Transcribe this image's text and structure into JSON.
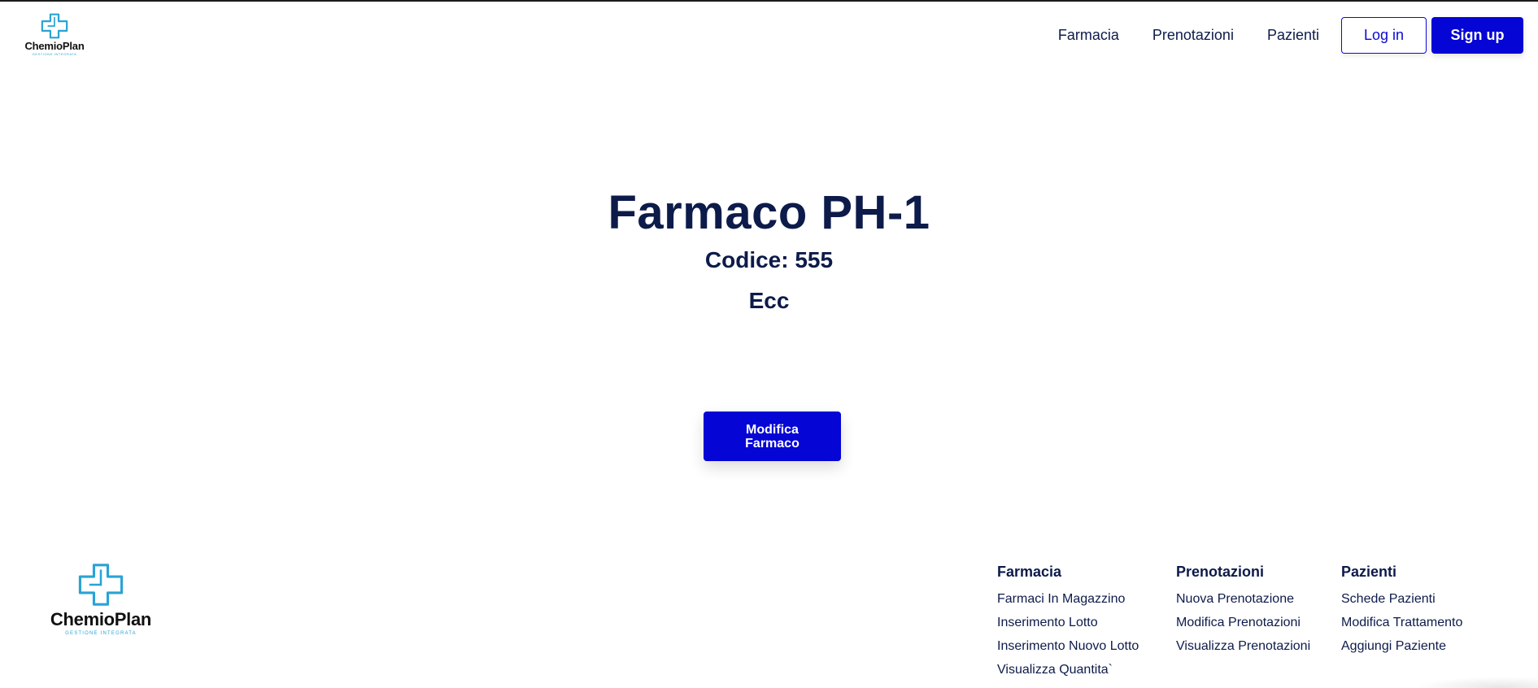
{
  "header": {
    "logo": {
      "brand": "ChemioPlan",
      "tagline": "GESTIONE INTEGRATA",
      "icon": "medical-cross-icon",
      "color": "#29a3d6"
    },
    "nav": [
      {
        "label": "Farmacia"
      },
      {
        "label": "Prenotazioni"
      },
      {
        "label": "Pazienti"
      }
    ],
    "login_label": "Log in",
    "signup_label": "Sign up"
  },
  "main": {
    "title": "Farmaco PH-1",
    "code": "Codice: 555",
    "extra": "Ecc",
    "edit_button_label": "Modifica Farmaco"
  },
  "footer": {
    "logo": {
      "brand": "ChemioPlan",
      "tagline": "GESTIONE INTEGRATA"
    },
    "columns": [
      {
        "title": "Farmacia",
        "links": [
          "Farmaci In Magazzino",
          "Inserimento Lotto",
          "Inserimento Nuovo Lotto",
          "Visualizza Quantita`"
        ]
      },
      {
        "title": "Prenotazioni",
        "links": [
          "Nuova Prenotazione",
          "Modifica Prenotazioni",
          "Visualizza Prenotazioni"
        ]
      },
      {
        "title": "Pazienti",
        "links": [
          "Schede Pazienti",
          "Modifica Trattamento",
          "Aggiungi Paziente"
        ]
      }
    ]
  },
  "colors": {
    "primary": "#0505d6",
    "text": "#0d1b4a",
    "logo_accent": "#29a3d6"
  }
}
